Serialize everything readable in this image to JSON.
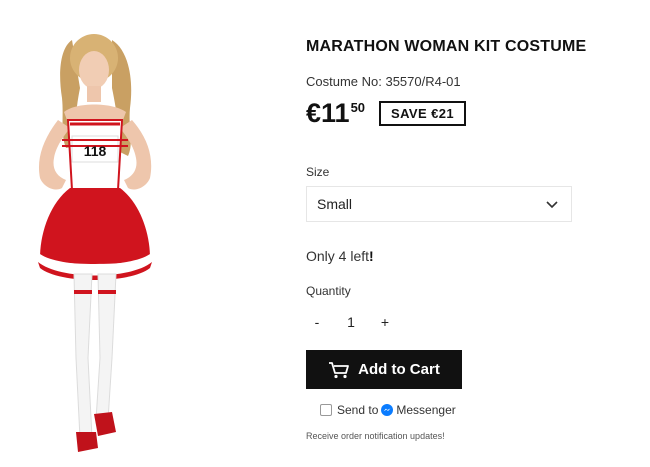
{
  "product": {
    "title": "MARATHON WOMAN KIT COSTUME",
    "sku": "Costume No: 35570/R4-01",
    "price_main": "€11",
    "price_cents": "50",
    "save_badge": "SAVE €21",
    "image_icon": "costume-photo",
    "bib_number": "118"
  },
  "size": {
    "label": "Size",
    "selected": "Small"
  },
  "stock": {
    "prefix": "Only 4 left",
    "suffix": "!"
  },
  "quantity": {
    "label": "Quantity",
    "minus": "-",
    "value": "1",
    "plus": "+"
  },
  "cart": {
    "label": "Add to Cart",
    "icon": "cart-icon"
  },
  "messenger": {
    "prefix": "Send to",
    "brand": "Messenger",
    "icon": "messenger-icon"
  },
  "notification_text": "Receive order notification updates!",
  "colors": {
    "accent": "#111111",
    "costume_red": "#d0141e",
    "messenger_blue": "#0a7cff"
  }
}
